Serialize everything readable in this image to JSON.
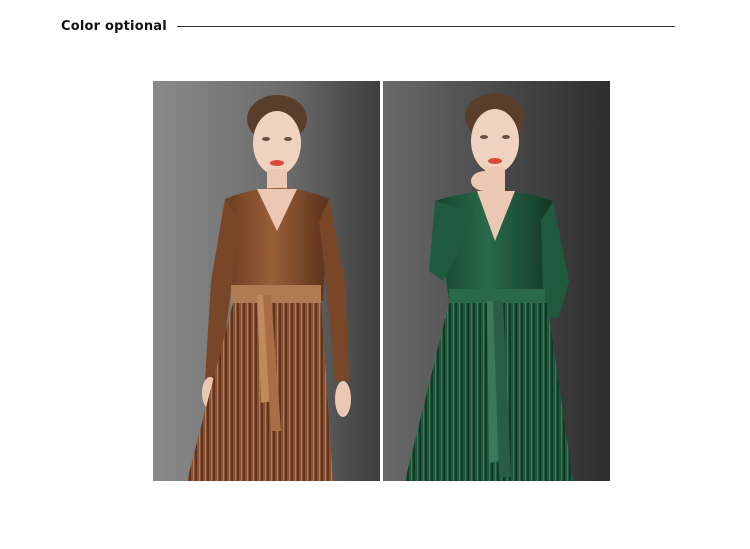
{
  "section": {
    "title": "Color optional"
  },
  "gallery": {
    "items": [
      {
        "color_name": "brown",
        "dress_color": "#8a5232",
        "dress_shadow": "#5e3420",
        "dress_highlight": "#b07a52"
      },
      {
        "color_name": "green",
        "dress_color": "#1f5a3f",
        "dress_shadow": "#123826",
        "dress_highlight": "#3a7a5a"
      }
    ],
    "background_colors": [
      "#7a7a7a",
      "#3c3c3c"
    ]
  }
}
